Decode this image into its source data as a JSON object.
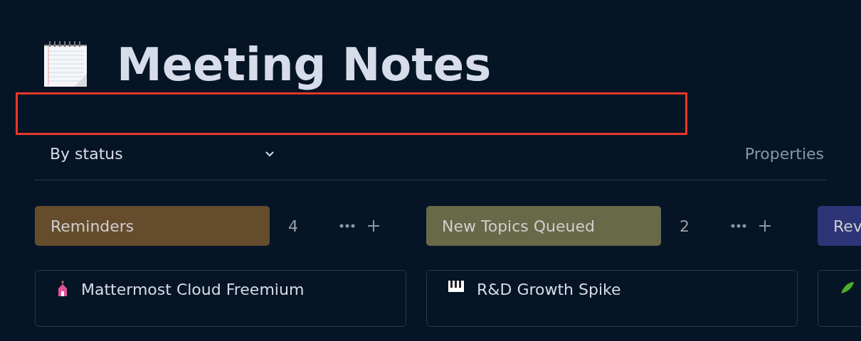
{
  "page": {
    "title": "Meeting Notes"
  },
  "view": {
    "label": "By status"
  },
  "properties_button": "Properties",
  "columns": [
    {
      "title": "Reminders",
      "color": "#654c2d",
      "count": "4",
      "cards": [
        {
          "kind": "church",
          "title": "Mattermost Cloud Freemium"
        }
      ]
    },
    {
      "title": "New Topics Queued",
      "color": "#686948",
      "count": "2",
      "cards": [
        {
          "kind": "piano",
          "title": "R&D Growth Spike"
        }
      ]
    },
    {
      "title": "Rev",
      "color": "#2d3577",
      "cards": [
        {
          "kind": "plant"
        }
      ]
    }
  ]
}
